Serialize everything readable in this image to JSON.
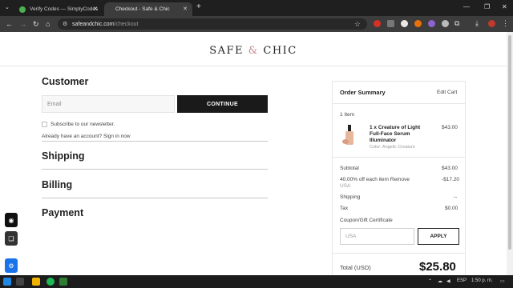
{
  "browser": {
    "tabs": [
      {
        "label": "Verify Codes — SimplyCodes",
        "active": false
      },
      {
        "label": "Checkout - Safe & Chic",
        "active": true
      }
    ],
    "new_tab": "+",
    "url_domain": "safeandchic.com",
    "url_path": "/checkout"
  },
  "colors": {
    "button_dark": "#1a1a1a",
    "accent_blue": "#1a73e8",
    "logo_amp": "#c98a8a"
  },
  "site": {
    "logo_left": "SAFE",
    "logo_amp": "&",
    "logo_right": "CHIC"
  },
  "checkout": {
    "customer_heading": "Customer",
    "email_placeholder": "Email",
    "continue_label": "CONTINUE",
    "newsletter_label": "Subscribe to our newsletter.",
    "signin_text": "Already have an account? Sign in now",
    "shipping_heading": "Shipping",
    "billing_heading": "Billing",
    "payment_heading": "Payment"
  },
  "summary": {
    "title": "Order Summary",
    "edit_cart": "Edit Cart",
    "item_count": "1 Item",
    "product_name_1": "1 x Creature of Light",
    "product_name_2": "Full-Face Serum",
    "product_name_3": "Illuminator",
    "product_color": "Color: Angelic Creature",
    "product_price": "$43.00",
    "subtotal_label": "Subtotal",
    "subtotal_value": "$43.00",
    "discount_label": "40.00% off each item Remove",
    "discount_sub": "USA",
    "discount_value": "-$17.20",
    "shipping_label": "Shipping",
    "shipping_value": "--",
    "tax_label": "Tax",
    "tax_value": "$0.00",
    "coupon_label": "Coupon/Gift Certificate",
    "coupon_value": "USA",
    "apply_label": "APPLY",
    "total_label": "Total (USD)",
    "total_value": "$25.80"
  },
  "taskbar": {
    "lang": "ESP",
    "time": "1:50 p. m."
  }
}
